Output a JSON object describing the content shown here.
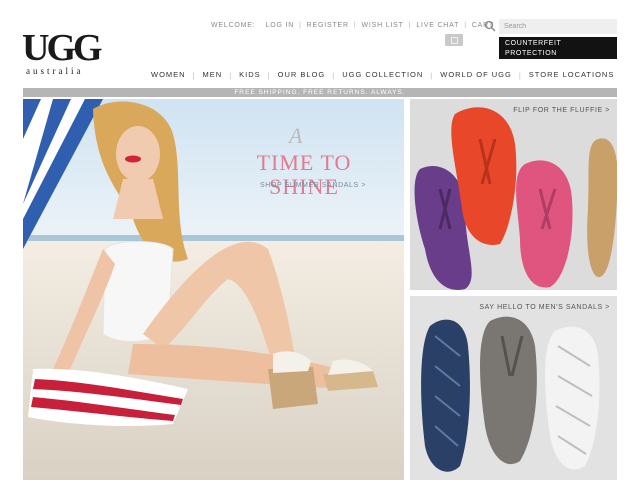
{
  "brand": {
    "logo_text": "UGG",
    "logo_sub": "australia"
  },
  "utility_nav": {
    "welcome": "WELCOME:",
    "login": "LOG IN",
    "register": "REGISTER",
    "wishlist": "WISH LIST",
    "livechat": "LIVE CHAT",
    "cart": "CART"
  },
  "search": {
    "placeholder": "Search",
    "icon": "search-icon"
  },
  "counterfeit": {
    "label": "COUNTERFEIT PROTECTION",
    "arrow": ">"
  },
  "main_nav": [
    {
      "label": "WOMEN"
    },
    {
      "label": "MEN"
    },
    {
      "label": "KIDS"
    },
    {
      "label": "OUR BLOG"
    },
    {
      "label": "UGG COLLECTION"
    },
    {
      "label": "WORLD OF UGG"
    },
    {
      "label": "STORE LOCATIONS"
    }
  ],
  "promo": {
    "text": "FREE SHIPPING. FREE RETURNS. ALWAYS."
  },
  "hero": {
    "script_a": "A",
    "title": "TIME TO SHINE",
    "cta": "SHOP SUMMER SANDALS >"
  },
  "panels": {
    "top_label": "FLIP FOR THE FLUFFIE >",
    "bottom_label": "SAY HELLO TO MEN'S SANDALS >"
  },
  "colors": {
    "title_pink": "#e07c90",
    "counterfeit_bg": "#121212",
    "promo_bg": "#b5b5b5"
  }
}
